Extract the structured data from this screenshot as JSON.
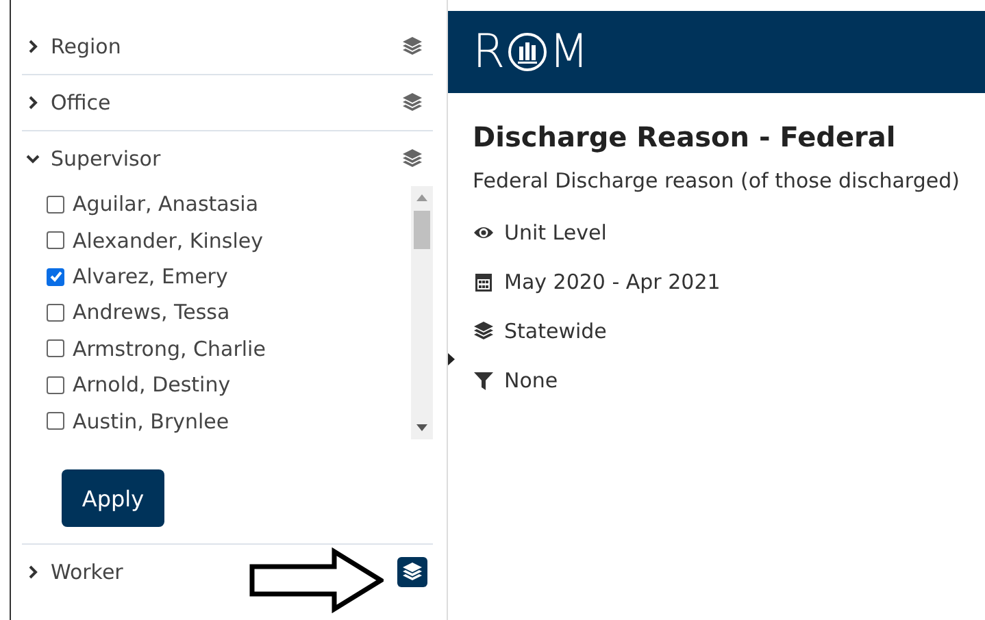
{
  "sidebar": {
    "facets": [
      {
        "label": "Region",
        "expanded": false,
        "active": false
      },
      {
        "label": "Office",
        "expanded": false,
        "active": false
      },
      {
        "label": "Supervisor",
        "expanded": true,
        "active": false,
        "options": [
          {
            "label": "Aguilar, Anastasia",
            "checked": false
          },
          {
            "label": "Alexander, Kinsley",
            "checked": false
          },
          {
            "label": "Alvarez, Emery",
            "checked": true
          },
          {
            "label": "Andrews, Tessa",
            "checked": false
          },
          {
            "label": "Armstrong, Charlie",
            "checked": false
          },
          {
            "label": "Arnold, Destiny",
            "checked": false
          },
          {
            "label": "Austin, Brynlee",
            "checked": false
          }
        ],
        "apply_button": "Apply"
      },
      {
        "label": "Worker",
        "expanded": false,
        "active": true
      }
    ]
  },
  "header": {
    "logo": {
      "left": "R",
      "right": "M"
    }
  },
  "report": {
    "title": "Discharge Reason - Federal",
    "subtitle": "Federal Discharge reason (of those discharged)",
    "meta": [
      {
        "kind": "level",
        "text": "Unit Level"
      },
      {
        "kind": "date",
        "text": "May 2020 - Apr 2021"
      },
      {
        "kind": "scope",
        "text": "Statewide"
      },
      {
        "kind": "filter",
        "text": "None"
      }
    ]
  }
}
